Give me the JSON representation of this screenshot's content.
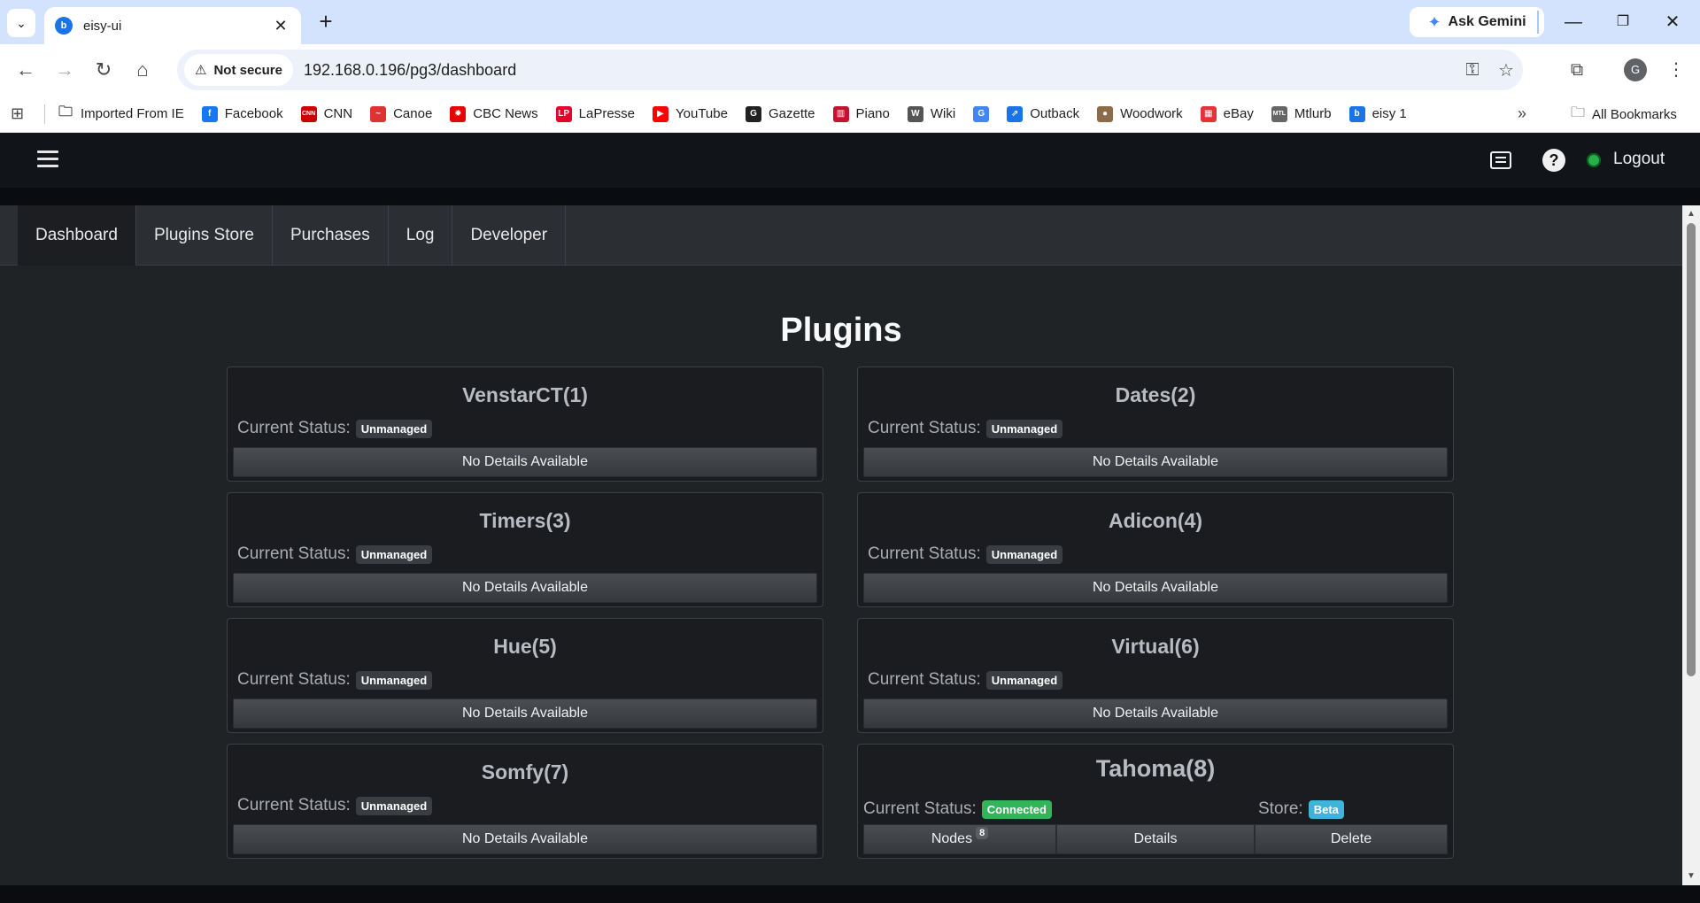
{
  "browser": {
    "tab_title": "eisy-ui",
    "tab_favicon": "eisy",
    "gemini_label": "Ask Gemini",
    "security_label": "Not secure",
    "url": "192.168.0.196/pg3/dashboard",
    "profile_initial": "G",
    "bookmarks": [
      {
        "label": "Imported From IE",
        "icon": "folder-icon"
      },
      {
        "label": "Facebook",
        "icon": "facebook-icon",
        "color": "#1877f2",
        "glyph": "f"
      },
      {
        "label": "CNN",
        "icon": "cnn-icon",
        "color": "#cc0000",
        "glyph": "CNN"
      },
      {
        "label": "Canoe",
        "icon": "canoe-icon",
        "color": "#d33",
        "glyph": "~"
      },
      {
        "label": "CBC News",
        "icon": "cbc-icon",
        "color": "#e60505",
        "glyph": "✹"
      },
      {
        "label": "LaPresse",
        "icon": "lapresse-icon",
        "color": "#e4002b",
        "glyph": "LP"
      },
      {
        "label": "YouTube",
        "icon": "youtube-icon",
        "color": "#ff0000",
        "glyph": "▶"
      },
      {
        "label": "Gazette",
        "icon": "gazette-icon",
        "color": "#222",
        "glyph": "G"
      },
      {
        "label": "Piano",
        "icon": "piano-icon",
        "color": "#c4122f",
        "glyph": "▥"
      },
      {
        "label": "Wiki",
        "icon": "wiki-icon",
        "color": "#555",
        "glyph": "W"
      },
      {
        "label": "",
        "icon": "google-icon",
        "color": "#4285f4",
        "glyph": "G"
      },
      {
        "label": "Outback",
        "icon": "outback-icon",
        "color": "#1a73e8",
        "glyph": "⇗"
      },
      {
        "label": "Woodwork",
        "icon": "woodwork-icon",
        "color": "#8b6b4a",
        "glyph": "●"
      },
      {
        "label": "eBay",
        "icon": "ebay-icon",
        "color": "#e53238",
        "glyph": "▦"
      },
      {
        "label": "Mtlurb",
        "icon": "mtlurb-icon",
        "color": "#666",
        "glyph": "MTL"
      },
      {
        "label": "eisy 1",
        "icon": "eisy-icon",
        "color": "#1a73e8",
        "glyph": "b"
      }
    ],
    "all_bookmarks_label": "All Bookmarks"
  },
  "app": {
    "logout_label": "Logout",
    "tabs": [
      "Dashboard",
      "Plugins Store",
      "Purchases",
      "Log",
      "Developer"
    ],
    "page_title": "Plugins",
    "status_prefix": "Current Status:",
    "no_details_label": "No Details Available",
    "plugins": [
      {
        "name": "VenstarCT(1)",
        "status": "Unmanaged"
      },
      {
        "name": "Dates(2)",
        "status": "Unmanaged"
      },
      {
        "name": "Timers(3)",
        "status": "Unmanaged"
      },
      {
        "name": "Adicon(4)",
        "status": "Unmanaged"
      },
      {
        "name": "Hue(5)",
        "status": "Unmanaged"
      },
      {
        "name": "Virtual(6)",
        "status": "Unmanaged"
      },
      {
        "name": "Somfy(7)",
        "status": "Unmanaged"
      },
      {
        "name": "Tahoma(8)",
        "status": "Connected",
        "store_label": "Store:",
        "store_value": "Beta",
        "nodes_label": "Nodes",
        "nodes_count": "8",
        "details_label": "Details",
        "delete_label": "Delete"
      }
    ]
  }
}
